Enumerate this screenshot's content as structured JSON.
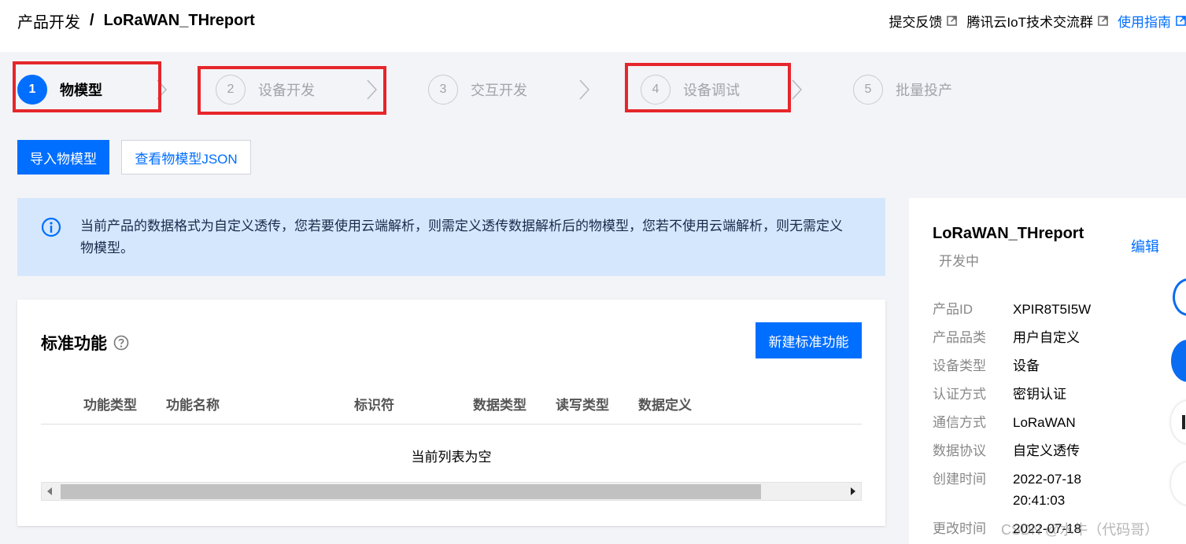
{
  "header": {
    "breadcrumb_root": "产品开发",
    "breadcrumb_sep": "/",
    "product_name": "LoRaWAN_THreport",
    "links": [
      {
        "label": "提交反馈"
      },
      {
        "label": "腾讯云IoT技术交流群"
      },
      {
        "label": "使用指南"
      }
    ]
  },
  "steps": [
    {
      "num": "1",
      "label": "物模型"
    },
    {
      "num": "2",
      "label": "设备开发"
    },
    {
      "num": "3",
      "label": "交互开发"
    },
    {
      "num": "4",
      "label": "设备调试"
    },
    {
      "num": "5",
      "label": "批量投产"
    }
  ],
  "actions": {
    "import_label": "导入物模型",
    "view_json_label": "查看物模型JSON"
  },
  "notice": {
    "text": "当前产品的数据格式为自定义透传，您若要使用云端解析，则需定义透传数据解析后的物模型，您若不使用云端解析，则无需定义物模型。"
  },
  "standard": {
    "title": "标准功能",
    "new_button": "新建标准功能",
    "columns": [
      "功能类型",
      "功能名称",
      "标识符",
      "数据类型",
      "读写类型",
      "数据定义"
    ],
    "empty_text": "当前列表为空"
  },
  "product_info": {
    "name": "LoRaWAN_THreport",
    "status": "开发中",
    "edit_label": "编辑",
    "rows": [
      {
        "key": "产品ID",
        "value": "XPIR8T5I5W"
      },
      {
        "key": "产品品类",
        "value": "用户自定义"
      },
      {
        "key": "设备类型",
        "value": "设备"
      },
      {
        "key": "认证方式",
        "value": "密钥认证"
      },
      {
        "key": "通信方式",
        "value": "LoRaWAN"
      },
      {
        "key": "数据协议",
        "value": "自定义透传"
      },
      {
        "key": "创建时间",
        "value": "2022-07-18"
      },
      {
        "key": "",
        "value": "20:41:03"
      },
      {
        "key": "更改时间",
        "value": "2022-07-18"
      }
    ]
  },
  "watermark": "CSDN @水牛（代码哥）",
  "colors": {
    "accent": "#006eff",
    "highlight_border": "#e6262b",
    "notice_bg": "#d5e7fd"
  }
}
